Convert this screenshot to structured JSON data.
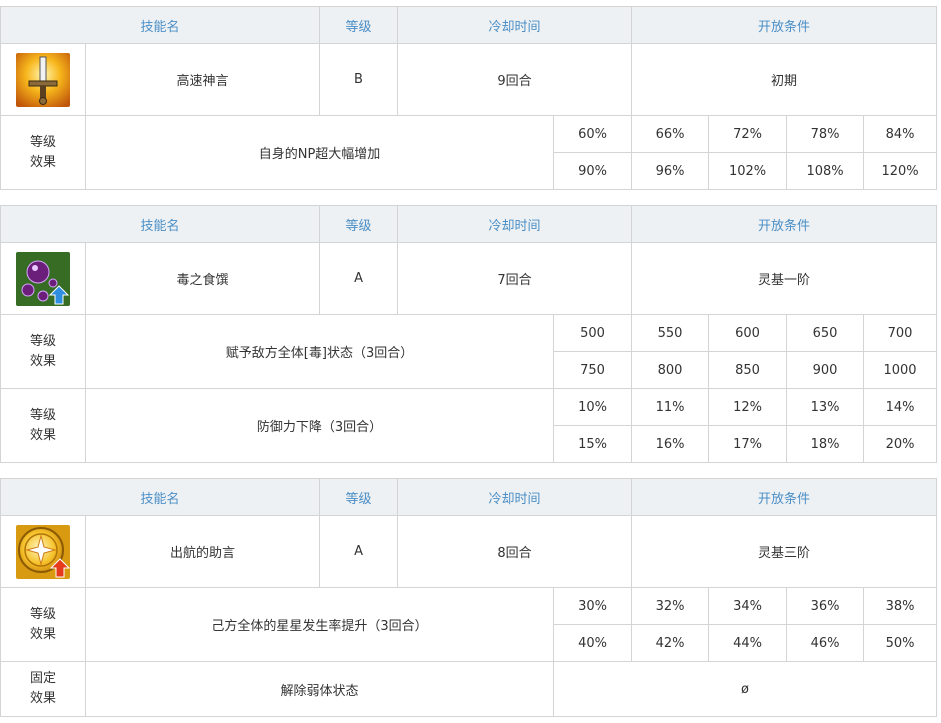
{
  "headers": {
    "name": "技能名",
    "rank": "等级",
    "cooldown": "冷却时间",
    "unlock": "开放条件"
  },
  "skills": [
    {
      "icon": "sword-buff-icon",
      "name": "高速神言",
      "rank": "B",
      "cooldown": "9回合",
      "unlock": "初期",
      "effects": [
        {
          "label_line1": "等级",
          "label_line2": "效果",
          "desc": "自身的NP超大幅增加",
          "values_row1": [
            "60%",
            "66%",
            "72%",
            "78%",
            "84%"
          ],
          "values_row2": [
            "90%",
            "96%",
            "102%",
            "108%",
            "120%"
          ]
        }
      ]
    },
    {
      "icon": "poison-orbs-icon",
      "name": "毒之食馔",
      "rank": "A",
      "cooldown": "7回合",
      "unlock": "灵基一阶",
      "effects": [
        {
          "label_line1": "等级",
          "label_line2": "效果",
          "desc": "赋予敌方全体[毒]状态（3回合）",
          "values_row1": [
            "500",
            "550",
            "600",
            "650",
            "700"
          ],
          "values_row2": [
            "750",
            "800",
            "850",
            "900",
            "1000"
          ]
        },
        {
          "label_line1": "等级",
          "label_line2": "效果",
          "desc": "防御力下降（3回合）",
          "values_row1": [
            "10%",
            "11%",
            "12%",
            "13%",
            "14%"
          ],
          "values_row2": [
            "15%",
            "16%",
            "17%",
            "18%",
            "20%"
          ]
        }
      ]
    },
    {
      "icon": "star-compass-icon",
      "name": "出航的助言",
      "rank": "A",
      "cooldown": "8回合",
      "unlock": "灵基三阶",
      "effects": [
        {
          "label_line1": "等级",
          "label_line2": "效果",
          "desc": "己方全体的星星发生率提升（3回合）",
          "values_row1": [
            "30%",
            "32%",
            "34%",
            "36%",
            "38%"
          ],
          "values_row2": [
            "40%",
            "42%",
            "44%",
            "46%",
            "50%"
          ]
        }
      ],
      "fixed_effect": {
        "label_line1": "固定",
        "label_line2": "效果",
        "desc": "解除弱体状态",
        "value": "ø"
      }
    }
  ]
}
